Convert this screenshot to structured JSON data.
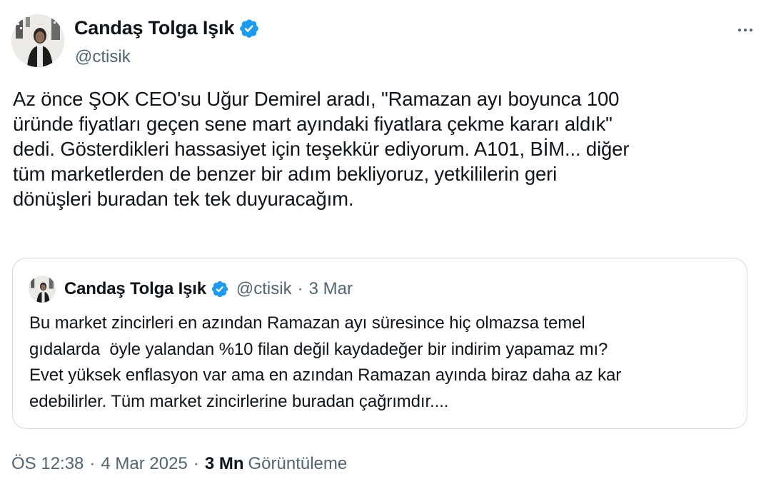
{
  "author": {
    "display_name": "Candaş Tolga Işık",
    "handle": "@ctisik",
    "avatar_icon": "avatar-photo",
    "verified_icon": "verified-badge-icon",
    "verified_color": "#1d9bf0"
  },
  "more_icon": "more-icon",
  "tweet": {
    "lines": [
      "Az önce ŞOK CEO'su Uğur Demirel aradı, \"Ramazan ayı boyunca 100",
      "üründe fiyatları geçen sene mart ayındaki fiyatlara çekme kararı aldık\"",
      "dedi. Gösterdikleri hassasiyet için teşekkür ediyorum. A101, BİM... diğer",
      "tüm marketlerden de benzer bir adım bekliyoruz, yetkililerin geri",
      "dönüşleri buradan tek tek duyuracağım."
    ]
  },
  "quote": {
    "display_name": "Candaş Tolga Işık",
    "handle": "@ctisik",
    "separator": "·",
    "date": "3 Mar",
    "lines": [
      "Bu market zincirleri en azından Ramazan ayı süresince hiç olmazsa temel",
      "gıdalarda  öyle yalandan %10 filan değil kaydadeğer bir indirim yapamaz mı?",
      "Evet yüksek enflasyon var ama en azından Ramazan ayında biraz daha az kar",
      "edebilirler. Tüm market zincirlerine buradan çağrımdır...."
    ]
  },
  "meta": {
    "time": "ÖS 12:38",
    "separator": "·",
    "date": "4 Mar 2025",
    "views_count": "3 Mn",
    "views_label": "Görüntüleme"
  },
  "colors": {
    "text_primary": "#0f1419",
    "text_secondary": "#536471",
    "border": "#cfd9de"
  }
}
